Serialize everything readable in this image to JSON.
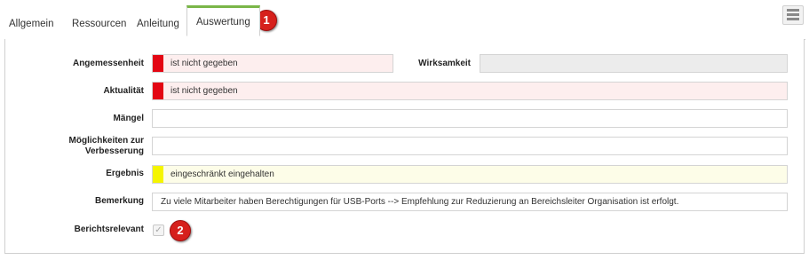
{
  "tabs": [
    {
      "label": "Allgemein"
    },
    {
      "label": "Ressourcen"
    },
    {
      "label": "Anleitung"
    },
    {
      "label": "Auswertung",
      "active": true
    }
  ],
  "markers": [
    "1",
    "2"
  ],
  "colors": {
    "rot": "#e30613",
    "gelb": "#f5f500",
    "tab_accent": "#7ab648"
  },
  "form": {
    "angemessenheit": {
      "label": "Angemessenheit",
      "value": "ist nicht gegeben",
      "color": "rot"
    },
    "wirksamkeit": {
      "label": "Wirksamkeit",
      "value": ""
    },
    "aktualitaet": {
      "label": "Aktualität",
      "value": "ist nicht gegeben",
      "color": "rot"
    },
    "maengel": {
      "label": "Mängel",
      "value": ""
    },
    "moeglichkeiten": {
      "label_line1": "Möglichkeiten zur",
      "label_line2": "Verbesserung",
      "value": ""
    },
    "ergebnis": {
      "label": "Ergebnis",
      "value": "eingeschränkt eingehalten",
      "color": "gelb"
    },
    "bemerkung": {
      "label": "Bemerkung",
      "value": "Zu viele Mitarbeiter haben Berechtigungen für USB-Ports --> Empfehlung zur Reduzierung an Bereichsleiter Organisation ist erfolgt."
    },
    "berichtsrelevant": {
      "label": "Berichtsrelevant",
      "checked": true
    }
  }
}
